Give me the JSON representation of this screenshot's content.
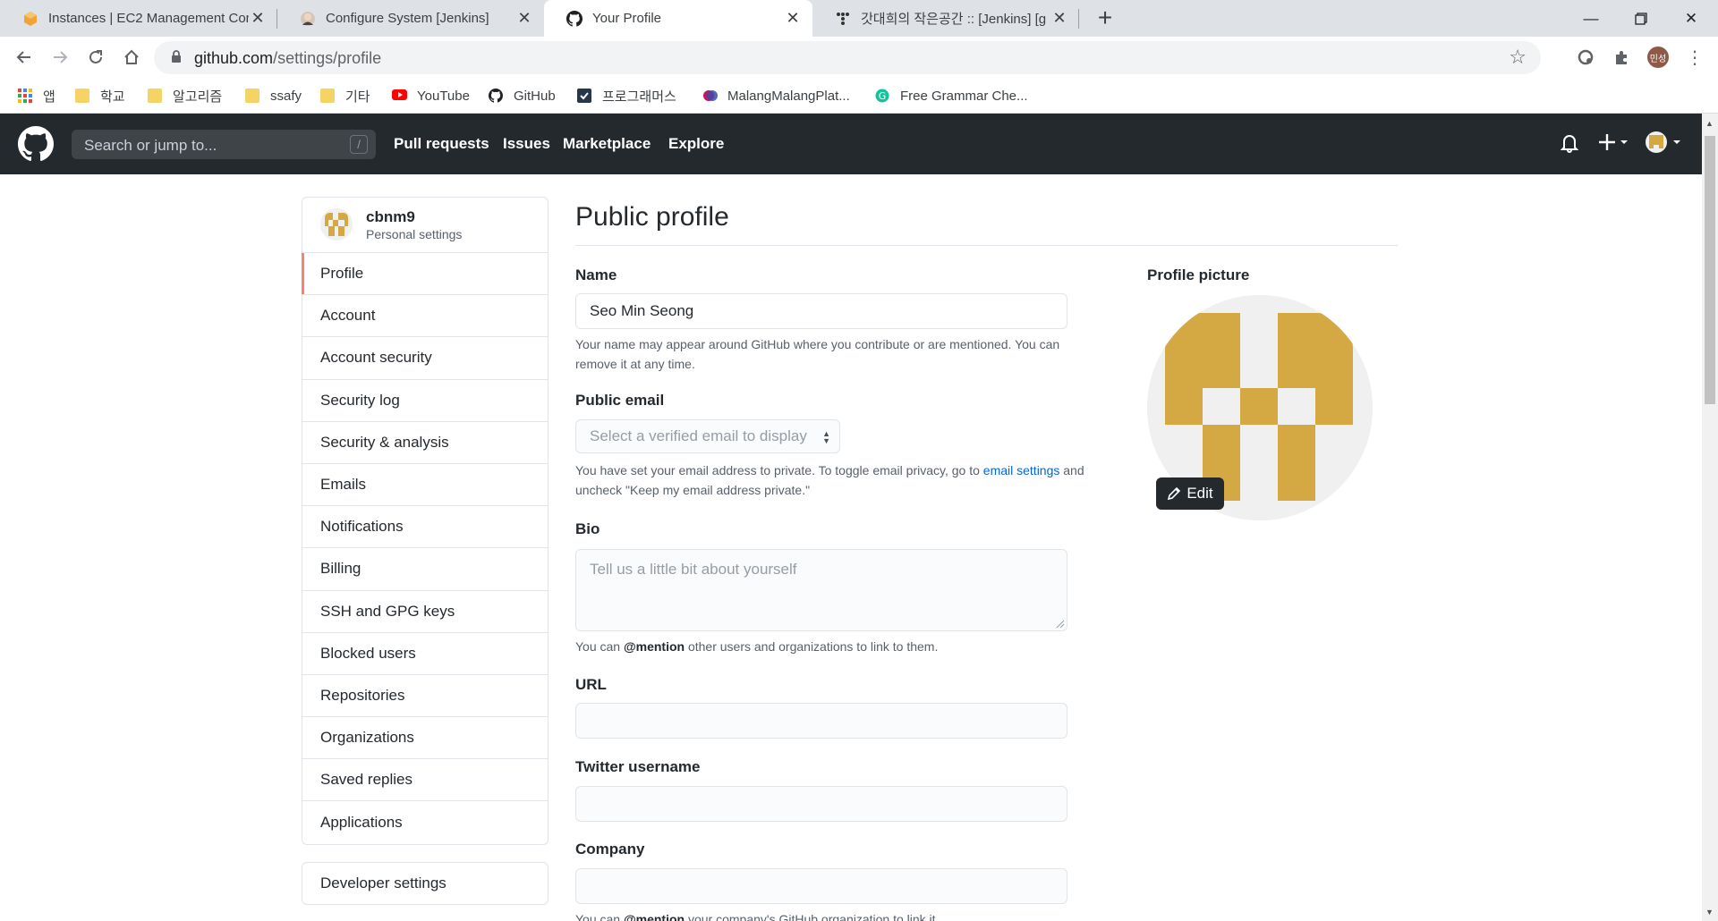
{
  "browser": {
    "tabs": [
      {
        "title": "Instances | EC2 Management Console",
        "active": false
      },
      {
        "title": "Configure System [Jenkins]",
        "active": false
      },
      {
        "title": "Your Profile",
        "active": true
      },
      {
        "title": "갓대희의 작은공간 :: [Jenkins] [g",
        "active": false
      }
    ],
    "url_host": "github.com",
    "url_path": "/settings/profile",
    "profile_chip": "민성",
    "bookmarks": [
      {
        "label": "앱",
        "icon": "apps-grid-icon"
      },
      {
        "label": "학교",
        "icon": "folder-icon"
      },
      {
        "label": "알고리즘",
        "icon": "folder-icon"
      },
      {
        "label": "ssafy",
        "icon": "folder-icon"
      },
      {
        "label": "기타",
        "icon": "folder-icon"
      },
      {
        "label": "YouTube",
        "icon": "youtube-icon"
      },
      {
        "label": "GitHub",
        "icon": "github-icon"
      },
      {
        "label": "프로그래머스",
        "icon": "programmers-icon"
      },
      {
        "label": "MalangMalangPlat...",
        "icon": "malang-icon"
      },
      {
        "label": "Free Grammar Che...",
        "icon": "grammar-icon"
      }
    ]
  },
  "github_header": {
    "search_placeholder": "Search or jump to...",
    "search_shortcut": "/",
    "nav": [
      "Pull requests",
      "Issues",
      "Marketplace",
      "Explore"
    ]
  },
  "sidebar": {
    "username": "cbnm9",
    "subtitle": "Personal settings",
    "items": [
      "Profile",
      "Account",
      "Account security",
      "Security log",
      "Security & analysis",
      "Emails",
      "Notifications",
      "Billing",
      "SSH and GPG keys",
      "Blocked users",
      "Repositories",
      "Organizations",
      "Saved replies",
      "Applications"
    ],
    "selected": "Profile",
    "developer_settings": "Developer settings"
  },
  "profile": {
    "title": "Public profile",
    "name_label": "Name",
    "name_value": "Seo Min Seong",
    "name_note": "Your name may appear around GitHub where you contribute or are mentioned. You can remove it at any time.",
    "email_label": "Public email",
    "email_select": "Select a verified email to display",
    "email_note_1": "You have set your email address to private. To toggle email privacy, go to",
    "email_note_link": "email settings",
    "email_note_2": "and uncheck \"Keep my email address private.\"",
    "bio_label": "Bio",
    "bio_placeholder": "Tell us a little bit about yourself",
    "bio_note_1": "You can",
    "bio_note_mention": "@mention",
    "bio_note_2": "other users and organizations to link to them.",
    "url_label": "URL",
    "twitter_label": "Twitter username",
    "company_label": "Company",
    "company_note_1": "You can",
    "company_note_mention": "@mention",
    "company_note_2": "your company's GitHub organization to link it.",
    "picture_label": "Profile picture",
    "edit_button": "Edit"
  },
  "colors": {
    "github_header_bg": "#24292e",
    "selected_accent": "#f9826c",
    "avatar_gold": "#d4a843",
    "link_blue": "#0366d6"
  }
}
